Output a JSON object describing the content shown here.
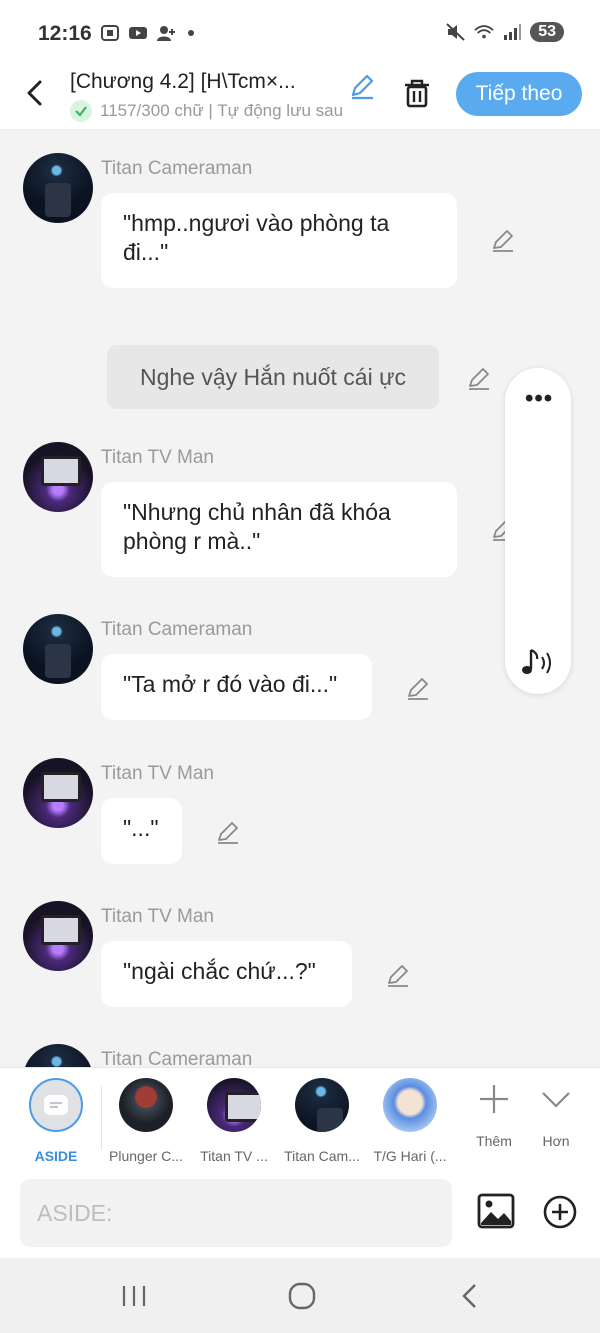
{
  "status_bar": {
    "time": "12:16",
    "battery": "53"
  },
  "header": {
    "title": "[Chương 4.2] [H\\Tcm×...",
    "subtitle": "1157/300 chữ | Tự động lưu sau",
    "next_label": "Tiếp theo"
  },
  "messages": [
    {
      "sender": "Titan Cameraman",
      "text": "\"hmp..ngươi vào phòng ta đi...\""
    },
    {
      "narration": "Nghe vậy Hắn nuốt cái ực"
    },
    {
      "sender": "Titan TV Man",
      "text": "\"Nhưng chủ nhân đã khóa phòng r mà..\""
    },
    {
      "sender": "Titan Cameraman",
      "text": "\"Ta mở r đó vào đi...\""
    },
    {
      "sender": "Titan TV Man",
      "text": "\"...\""
    },
    {
      "sender": "Titan TV Man",
      "text": "\"ngài chắc chứ...?\""
    },
    {
      "sender": "Titan Cameraman"
    }
  ],
  "side_panel": {
    "more_icon": "more-dots-icon",
    "music_icon": "music-note-icon"
  },
  "characters": [
    {
      "label": "ASIDE"
    },
    {
      "label": "Plunger C..."
    },
    {
      "label": "Titan TV ..."
    },
    {
      "label": "Titan Cam..."
    },
    {
      "label": "T/G Hari (..."
    }
  ],
  "tools": {
    "add_label": "Thêm",
    "more_label": "Hơn"
  },
  "input": {
    "placeholder": "ASIDE:"
  },
  "colors": {
    "accent": "#5aaaf0",
    "aside_blue": "#3a8de0"
  }
}
